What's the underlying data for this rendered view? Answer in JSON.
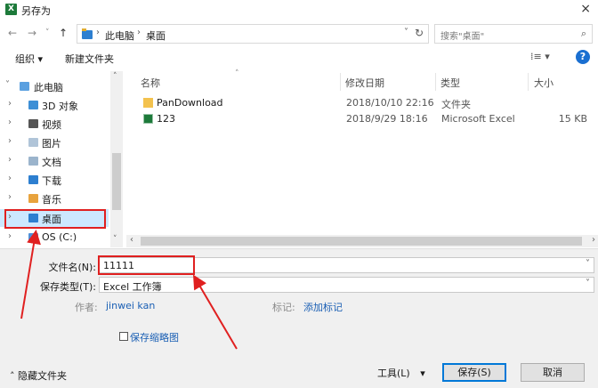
{
  "window": {
    "title": "另存为",
    "app_icon_glyph": "X",
    "close_glyph": "×"
  },
  "address": {
    "back": "←",
    "forward": "→",
    "recent": "˅",
    "up": "↑",
    "sep": "›",
    "path": [
      "此电脑",
      "桌面"
    ],
    "dropdown": "˅",
    "refresh": "↻"
  },
  "search": {
    "placeholder": "搜索\"桌面\"",
    "icon": "⌕"
  },
  "toolbar": {
    "organize": "组织 ▾",
    "new_folder": "新建文件夹",
    "view": "⁞≡ ▾",
    "help": "?"
  },
  "nav": {
    "items": [
      {
        "label": "此电脑",
        "chevron": "˅",
        "icon_color": "#5aa0e0"
      },
      {
        "label": "3D 对象",
        "chevron": "›",
        "icon_color": "#3d8fd6"
      },
      {
        "label": "视频",
        "chevron": "›",
        "icon_color": "#555555"
      },
      {
        "label": "图片",
        "chevron": "›",
        "icon_color": "#b0c4d8"
      },
      {
        "label": "文档",
        "chevron": "›",
        "icon_color": "#9bb4cc"
      },
      {
        "label": "下载",
        "chevron": "›",
        "icon_color": "#2d7fd0"
      },
      {
        "label": "音乐",
        "chevron": "›",
        "icon_color": "#e8a33d"
      },
      {
        "label": "桌面",
        "chevron": "›",
        "icon_color": "#2d7fd0"
      },
      {
        "label": "OS (C:)",
        "chevron": "›",
        "icon_color": "#4f8fd8"
      }
    ],
    "selected": "桌面",
    "scroll_up": "˄",
    "scroll_down": "˅"
  },
  "file_list": {
    "columns": [
      "名称",
      "修改日期",
      "类型",
      "大小"
    ],
    "sort_caret": "˄",
    "rows": [
      {
        "name": "PanDownload",
        "date": "2018/10/10 22:16",
        "type": "文件夹",
        "size": "",
        "icon": "folder-icon",
        "icon_color": "#f3c24e"
      },
      {
        "name": "123",
        "date": "2018/9/29 18:16",
        "type": "Microsoft Excel",
        "size": "15 KB",
        "icon": "excel-file-icon",
        "icon_color": "#1d7a3a"
      }
    ],
    "hscroll_left": "‹",
    "hscroll_right": "›"
  },
  "form": {
    "filename_label": "文件名(N):",
    "filename_value": "11111",
    "savetype_label": "保存类型(T):",
    "savetype_value": "Excel 工作簿",
    "dropdown": "˅",
    "author_label": "作者:",
    "author_value": "jinwei kan",
    "tags_label": "标记:",
    "tags_value": "添加标记",
    "thumbnail_label": "保存缩略图"
  },
  "footer": {
    "hide_folders": "˄ 隐藏文件夹",
    "tools": "工具(L)",
    "tools_caret": "▾",
    "save": "保存(S)",
    "cancel": "取消"
  },
  "colors": {
    "annotation_red": "#e02020",
    "selection_blue": "#cce8ff",
    "link_blue": "#1a5fb4"
  }
}
